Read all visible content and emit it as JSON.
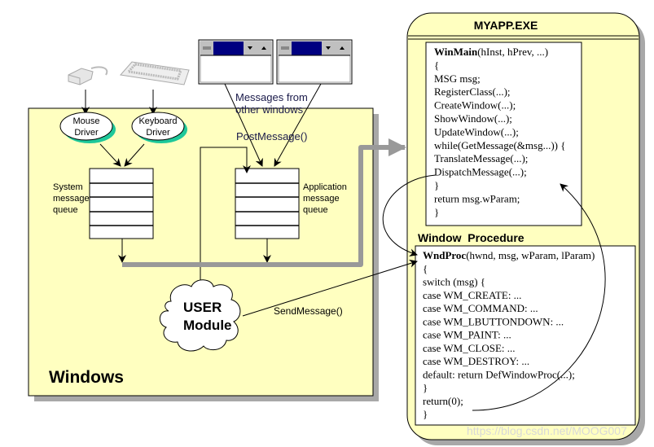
{
  "windows_box": {
    "label": "Windows"
  },
  "devices": {
    "mouse_icon": "mouse-icon",
    "keyboard_icon": "keyboard-icon"
  },
  "drivers": {
    "mouse": [
      "Mouse",
      "Driver"
    ],
    "keyboard": [
      "Keyboard",
      "Driver"
    ]
  },
  "system_queue": {
    "label": [
      "System",
      "message",
      "queue"
    ]
  },
  "app_queue": {
    "label": [
      "Application",
      "message",
      "queue"
    ]
  },
  "other_windows": {
    "label": [
      "Messages from",
      "other windows"
    ]
  },
  "post_message": "PostMessage()",
  "send_message": "SendMessage()",
  "user_module": [
    "USER",
    "Module"
  ],
  "app": {
    "title": "MYAPP.EXE",
    "winmain": {
      "name": "WinMain",
      "signature": "(hInst, hPrev, ...)",
      "lines": [
        "{",
        "MSG  msg;",
        "RegisterClass(...);",
        "CreateWindow(...);",
        "ShowWindow(...);",
        "UpdateWindow(...);",
        "while(GetMessage(&msg...)) {",
        "   TranslateMessage(...);",
        "   DispatchMessage(...);",
        "}",
        "return msg.wParam;",
        "}"
      ]
    },
    "window_procedure_label": "Window  Procedure",
    "wndproc": {
      "name": "WndProc",
      "signature": "(hwnd, msg, wParam, lParam)",
      "lines": [
        "{",
        "switch (msg) {",
        "   case WM_CREATE: ...",
        "   case WM_COMMAND: ...",
        "   case WM_LBUTTONDOWN: ...",
        "   case WM_PAINT: ...",
        "   case WM_CLOSE: ...",
        "   case WM_DESTROY: ...",
        "   default: return DefWindowProc(...);",
        "}",
        "return(0);",
        "}"
      ]
    }
  },
  "watermark": "https://blog.csdn.net/MOOG007",
  "colors": {
    "panel": "#ffffc0",
    "shadow": "#a8a8a8",
    "driver_shadow": "#1fc89a",
    "titlebar": "#000080"
  }
}
